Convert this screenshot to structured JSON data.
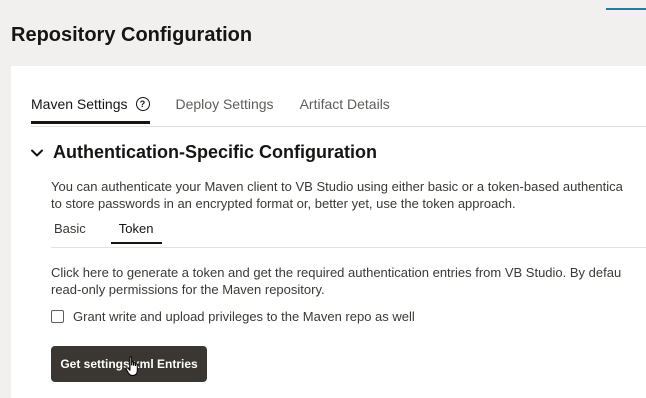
{
  "page": {
    "title": "Repository Configuration"
  },
  "tabs": [
    {
      "label": "Maven Settings",
      "active": true,
      "icon": "help-icon"
    },
    {
      "label": "Deploy Settings",
      "active": false
    },
    {
      "label": "Artifact Details",
      "active": false
    }
  ],
  "section": {
    "title": "Authentication-Specific Configuration",
    "expanded": true,
    "icon": "chevron-down-icon",
    "description_line1": "You can authenticate your Maven client to VB Studio using either basic or a token-based authentica",
    "description_line2": "to store passwords in an encrypted format or, better yet, use the token approach."
  },
  "auth_tabs": [
    {
      "label": "Basic",
      "active": false
    },
    {
      "label": "Token",
      "active": true
    }
  ],
  "token_panel": {
    "text_line1": "Click here to generate a token and get the required authentication entries from VB Studio. By defau",
    "text_line2": "read-only permissions for the Maven repository.",
    "checkbox_label": "Grant write and upload privileges to the Maven repo as well",
    "checkbox_checked": false,
    "button_label": "Get settings.xml Entries"
  },
  "colors": {
    "background": "#f1f0ef",
    "panel": "#ffffff",
    "button": "#3a3631",
    "accent": "#227e9e"
  }
}
